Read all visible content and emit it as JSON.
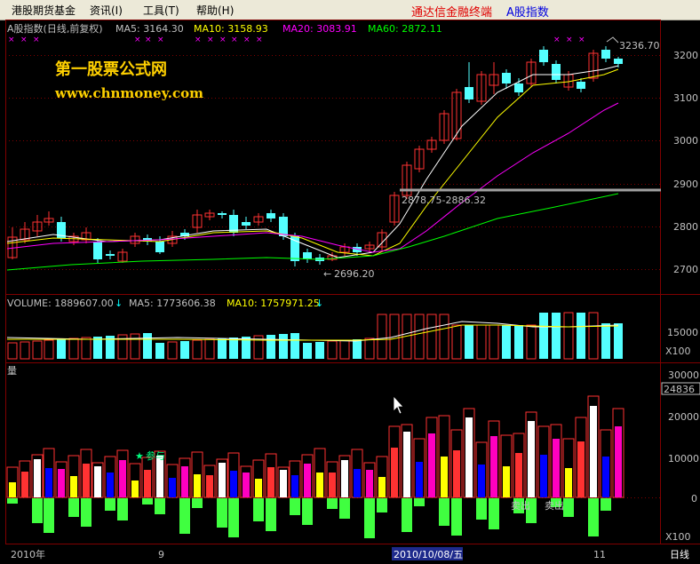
{
  "app": {
    "title": "通达信金融终端",
    "stock_title": "A股指数"
  },
  "menu": {
    "items": [
      {
        "label": "港股期货基金",
        "name": "menu-hk-futures-funds"
      },
      {
        "label": "资讯(I)",
        "name": "menu-info"
      },
      {
        "label": "工具(T)",
        "name": "menu-tools"
      },
      {
        "label": "帮助(H)",
        "name": "menu-help"
      }
    ]
  },
  "price_panel": {
    "title": "A股指数(日线,前复权)",
    "ma5": "MA5: 3164.30",
    "ma10": "MA10: 3158.93",
    "ma20": "MA20: 3083.91",
    "ma60": "MA60: 2872.11",
    "high_label": "3236.70",
    "low_label": "2696.20",
    "gap_label": "2878.75-2886.32",
    "y_ticks": [
      "3200",
      "3100",
      "3000",
      "2900",
      "2800",
      "2700"
    ]
  },
  "volume_panel": {
    "title": "VOLUME: 1889607.00",
    "ma5": "MA5: 1773606.38",
    "ma10": "MA10: 1757971.25",
    "y_tick": "15000",
    "multiplier": "X100"
  },
  "indicator_panel": {
    "title": "量",
    "y_ticks": [
      "30000",
      "20000",
      "10000",
      "0"
    ],
    "current_value": "24836",
    "multiplier": "X100",
    "buy_label": "参与",
    "sell_label_1": "卖出",
    "sell_label_2": "卖出"
  },
  "x_axis": {
    "labels": [
      "2010年",
      "9",
      "2010/10/08/五",
      "11"
    ],
    "period": "日线"
  },
  "watermark": {
    "title": "第一股票公式网",
    "url": "www.chnmoney.com"
  },
  "colors": {
    "up": "#ff3232",
    "down": "#54ffff",
    "ma5": "#ffffff",
    "ma10": "#ffff00",
    "ma20": "#ff00ff",
    "ma60": "#00ff00",
    "grid": "#800000",
    "axis_text": "#c0c0c0"
  }
}
